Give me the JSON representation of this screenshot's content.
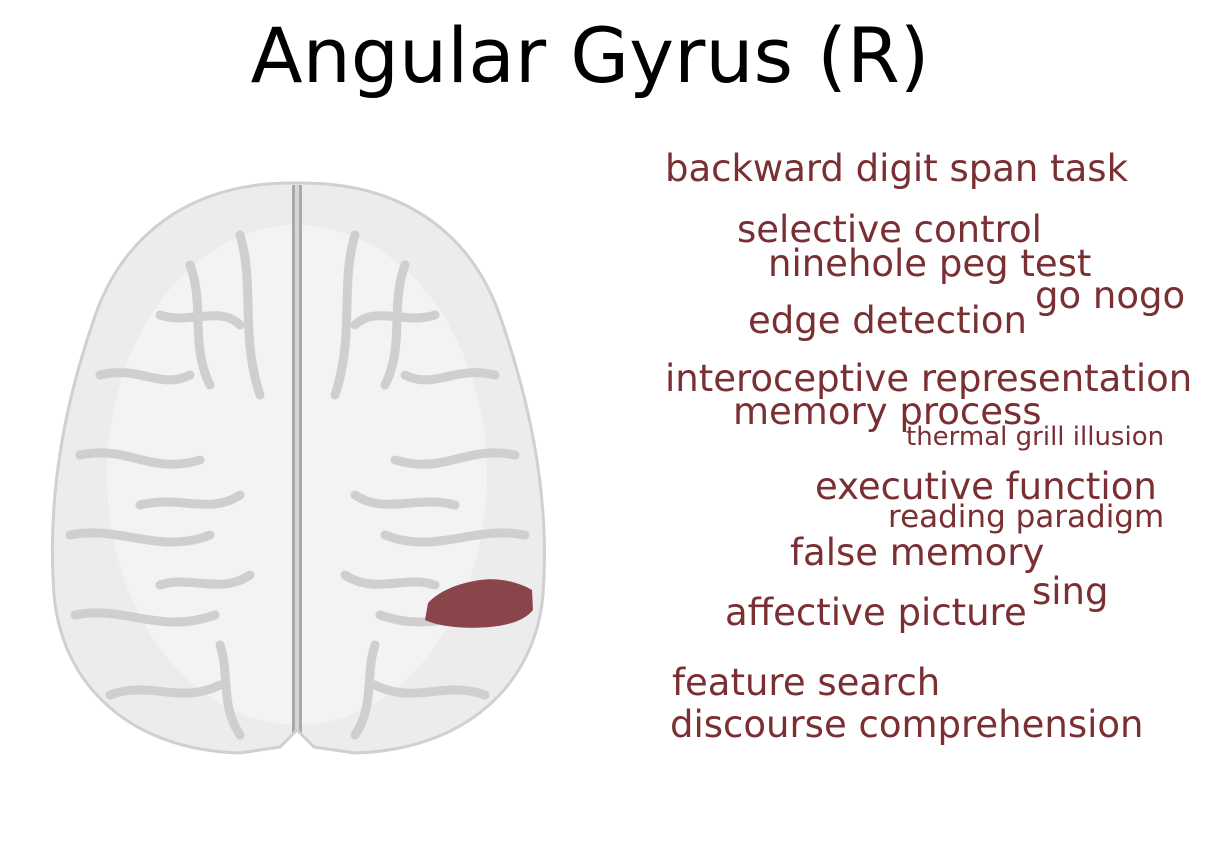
{
  "title": "Angular Gyrus (R)",
  "colors": {
    "term_text": "#7a2f33",
    "region_fill": "#8a454b",
    "brain_fill": "#ececec",
    "sulcus": "#c8c8c8"
  },
  "terms": [
    "backward digit span task",
    "selective control",
    "ninehole peg test",
    "go nogo",
    "edge detection",
    "interoceptive representation",
    "memory process",
    "thermal grill illusion",
    "executive function",
    "reading paradigm",
    "false memory",
    "sing",
    "affective picture",
    "feature search",
    "discourse comprehension"
  ]
}
